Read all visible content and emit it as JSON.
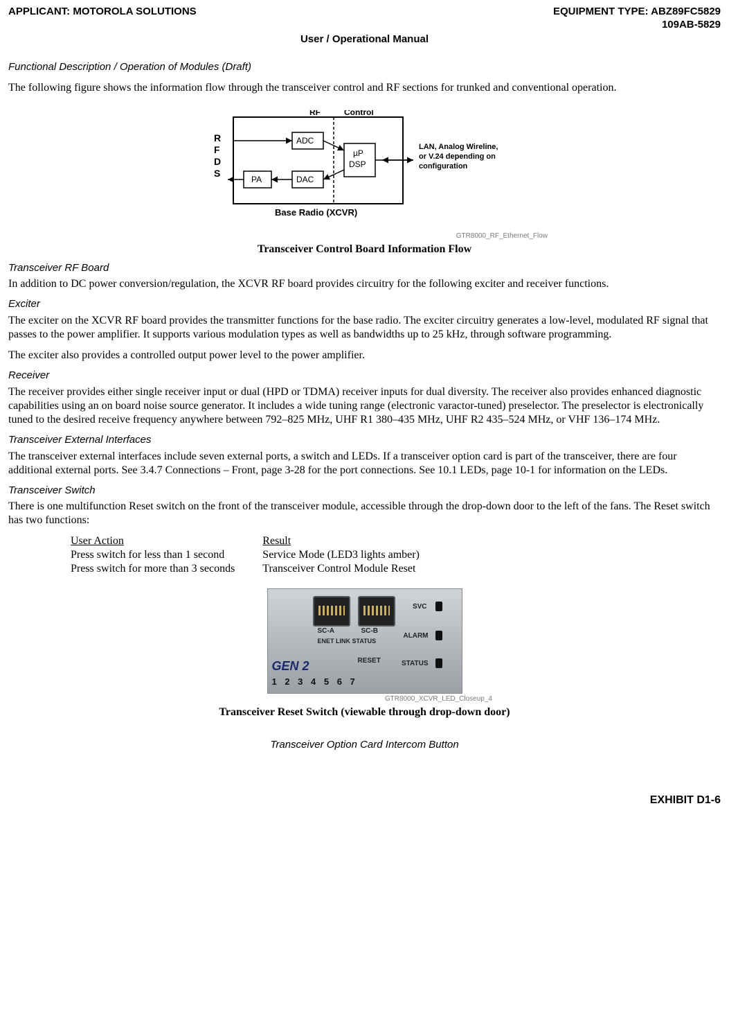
{
  "header": {
    "applicant_label": "APPLICANT: MOTOROLA SOLUTIONS",
    "equipment_label": "EQUIPMENT TYPE: ABZ89FC5829",
    "equipment_sub": "109AB-5829",
    "manual_title": "User / Operational Manual"
  },
  "section_title": "Functional Description / Operation of Modules (Draft)",
  "intro_para": "The following figure shows the information flow through the transceiver control and RF sections for trunked and conventional operation.",
  "figure1": {
    "labels": {
      "rfds": "R\nF\nD\nS",
      "pa": "PA",
      "adc": "ADC",
      "dac": "DAC",
      "rf": "RF",
      "control": "Control",
      "updsp_line1": "µP",
      "updsp_line2": "DSP",
      "side_line1": "LAN, Analog Wireline,",
      "side_line2": "or V.24 depending on",
      "side_line3": "configuration",
      "bottom": "Base Radio (XCVR)",
      "credit": "GTR8000_RF_Ethernet_Flow"
    },
    "caption": "Transceiver Control Board Information Flow"
  },
  "rfboard": {
    "title": "Transceiver RF Board",
    "para": "In addition to DC power conversion/regulation, the XCVR RF board provides circuitry for the following exciter and receiver functions."
  },
  "exciter": {
    "title": "Exciter",
    "para1": "The exciter on the XCVR RF board provides the transmitter functions for the base radio. The exciter circuitry generates a low-level, modulated RF signal that passes to the power amplifier. It supports various modulation types as well as bandwidths up to 25 kHz, through software programming.",
    "para2": "The exciter also provides a controlled output power level to the power amplifier."
  },
  "receiver": {
    "title": "Receiver",
    "para": "The receiver provides either single receiver input or dual (HPD or TDMA) receiver inputs for dual diversity. The receiver also provides enhanced diagnostic capabilities using an on board noise source generator. It includes a wide tuning range (electronic varactor-tuned) preselector. The preselector is electronically tuned to the desired receive frequency anywhere between 792–825 MHz, UHF R1 380–435 MHz, UHF R2 435–524 MHz, or VHF 136–174 MHz."
  },
  "ext_if": {
    "title": "Transceiver External Interfaces",
    "para": "The transceiver external interfaces include seven external ports, a switch and LEDs. If a transceiver option card is part of the transceiver, there are four additional external ports. See 3.4.7 Connections – Front, page 3-28 for the port connections. See 10.1 LEDs, page 10-1 for information on the LEDs."
  },
  "switch": {
    "title": "Transceiver Switch",
    "para": "There is one multifunction Reset switch on the front of the transceiver module, accessible through the drop-down door to the left of the fans. The Reset switch has two functions:",
    "table": {
      "headers": [
        "User Action",
        "Result"
      ],
      "rows": [
        [
          "Press switch for less than 1 second",
          "Service Mode (LED3 lights amber)"
        ],
        [
          "Press switch for more than 3 seconds",
          "Transceiver Control Module Reset"
        ]
      ]
    }
  },
  "figure2": {
    "labels": {
      "gen2": "GEN 2",
      "sca": "SC-A",
      "scb": "SC-B",
      "svc": "SVC",
      "enet": "ENET LINK STATUS",
      "reset": "RESET",
      "alarm": "ALARM",
      "status": "STATUS",
      "nums": "1 2 3 4 5 6 7",
      "credit": "GTR8000_XCVR_LED_Closeup_4"
    },
    "caption": "Transceiver Reset Switch (viewable through drop-down door)"
  },
  "option_card_title": "Transceiver Option Card Intercom Button",
  "footer": "EXHIBIT D1-6"
}
